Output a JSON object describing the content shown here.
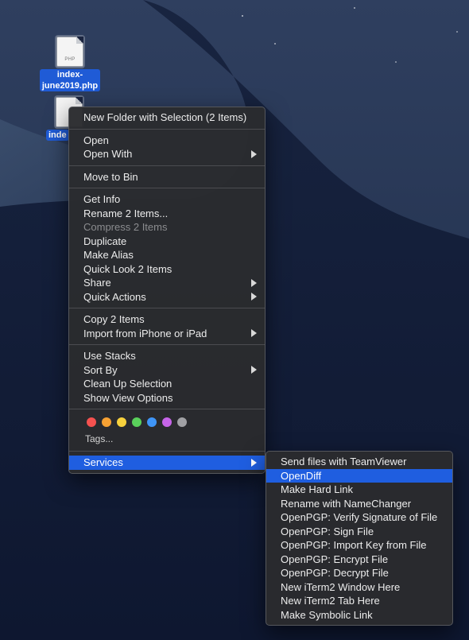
{
  "desktop": {
    "files": [
      {
        "name": "index-june2019.php",
        "line1": "index-",
        "line2": "june2019.php",
        "ext": "PHP"
      },
      {
        "name": "index",
        "line1": "inde",
        "ext": ""
      }
    ]
  },
  "context_menu": {
    "groups": [
      [
        {
          "label": "New Folder with Selection (2 Items)"
        }
      ],
      [
        {
          "label": "Open"
        },
        {
          "label": "Open With",
          "submenu": true
        }
      ],
      [
        {
          "label": "Move to Bin"
        }
      ],
      [
        {
          "label": "Get Info"
        },
        {
          "label": "Rename 2 Items..."
        },
        {
          "label": "Compress 2 Items",
          "disabled": true
        },
        {
          "label": "Duplicate"
        },
        {
          "label": "Make Alias"
        },
        {
          "label": "Quick Look 2 Items"
        },
        {
          "label": "Share",
          "submenu": true
        },
        {
          "label": "Quick Actions",
          "submenu": true
        }
      ],
      [
        {
          "label": "Copy 2 Items"
        },
        {
          "label": "Import from iPhone or iPad",
          "submenu": true
        }
      ],
      [
        {
          "label": "Use Stacks"
        },
        {
          "label": "Sort By",
          "submenu": true
        },
        {
          "label": "Clean Up Selection"
        },
        {
          "label": "Show View Options"
        }
      ]
    ],
    "tags": {
      "colors": [
        {
          "name": "red",
          "hex": "#f5514f"
        },
        {
          "name": "orange",
          "hex": "#f6a133"
        },
        {
          "name": "yellow",
          "hex": "#f7d13d"
        },
        {
          "name": "green",
          "hex": "#5ad05b"
        },
        {
          "name": "blue",
          "hex": "#3f95f7"
        },
        {
          "name": "purple",
          "hex": "#c664e8"
        },
        {
          "name": "gray",
          "hex": "#a0a0a4"
        }
      ],
      "label": "Tags..."
    },
    "services_label": "Services"
  },
  "services_submenu": {
    "items": [
      {
        "label": "Send files with TeamViewer"
      },
      {
        "label": "OpenDiff",
        "highlighted": true
      },
      {
        "label": "Make Hard Link"
      },
      {
        "label": "Rename with NameChanger"
      },
      {
        "label": "OpenPGP: Verify Signature of File"
      },
      {
        "label": "OpenPGP: Sign File"
      },
      {
        "label": "OpenPGP: Import Key from File"
      },
      {
        "label": "OpenPGP: Encrypt File"
      },
      {
        "label": "OpenPGP: Decrypt File"
      },
      {
        "label": "New iTerm2 Window Here"
      },
      {
        "label": "New iTerm2 Tab Here"
      },
      {
        "label": "Make Symbolic Link"
      }
    ]
  },
  "colors": {
    "highlight": "#1f5ee0",
    "selection": "#1f5bd6"
  }
}
